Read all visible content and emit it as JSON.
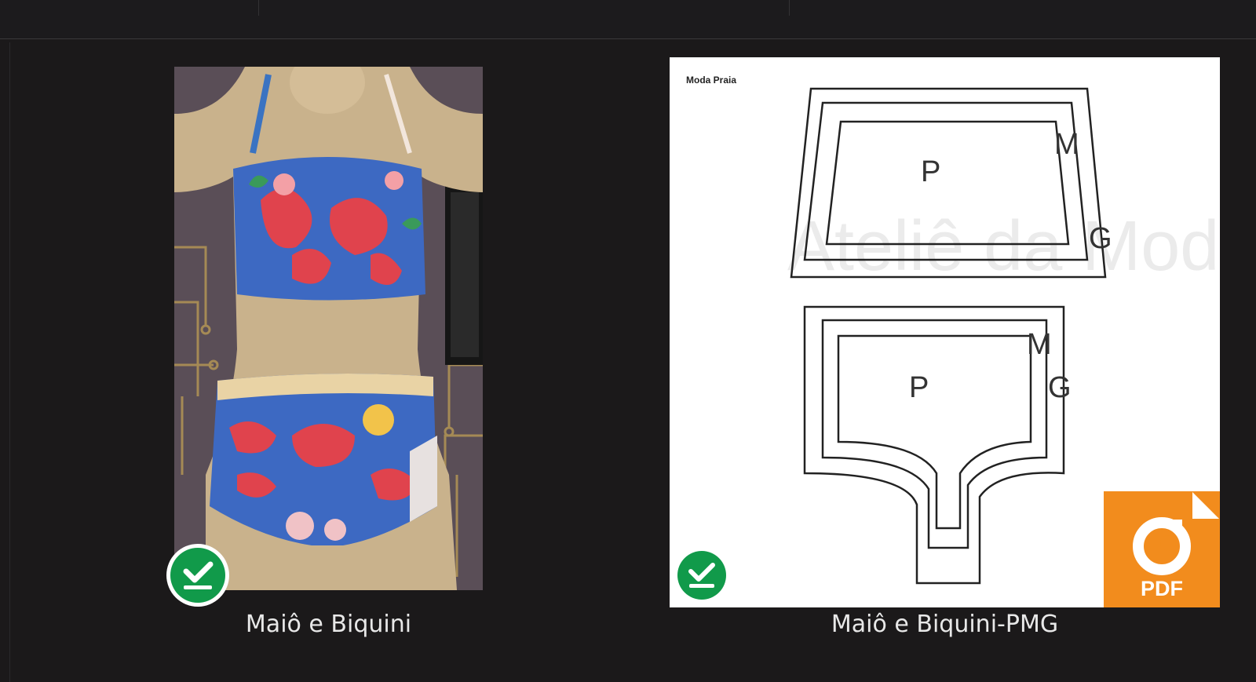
{
  "files": [
    {
      "name": "Maiô e Biquini",
      "status_icon": "sync-complete-icon",
      "thumbnail": "photo-swimsuit"
    },
    {
      "name": "Maiô e Biquini-PMG",
      "status_icon": "sync-complete-icon",
      "thumbnail": "pdf-pattern",
      "preview": {
        "header": "Moda Praia",
        "watermark": "Ateliê da Moda",
        "top_piece_labels": [
          "P",
          "M",
          "G"
        ],
        "bottom_piece_labels": [
          "M",
          "P",
          "G"
        ],
        "app_badge": "PDF"
      }
    }
  ],
  "colors": {
    "background": "#1b191a",
    "caption": "#e8e8e8",
    "status_green": "#119a4a",
    "pdf_orange": "#f28c1d"
  }
}
